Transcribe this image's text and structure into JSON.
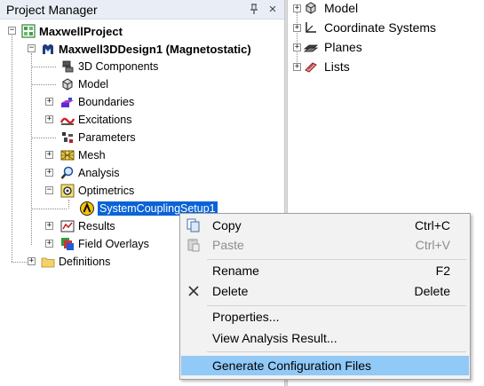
{
  "project_manager": {
    "title": "Project Manager",
    "pin_glyph": "×",
    "tree": {
      "project": "MaxwellProject",
      "design": "Maxwell3DDesign1 (Magnetostatic)",
      "nodes": {
        "components": "3D Components",
        "model": "Model",
        "boundaries": "Boundaries",
        "excitations": "Excitations",
        "parameters": "Parameters",
        "mesh": "Mesh",
        "analysis": "Analysis",
        "optimetrics": "Optimetrics",
        "setup": "SystemCouplingSetup1",
        "results": "Results",
        "field_overlays": "Field Overlays",
        "definitions": "Definitions"
      }
    }
  },
  "model_tree": {
    "items": [
      "Model",
      "Coordinate Systems",
      "Planes",
      "Lists"
    ]
  },
  "context_menu": {
    "copy": {
      "label": "Copy",
      "shortcut": "Ctrl+C"
    },
    "paste": {
      "label": "Paste",
      "shortcut": "Ctrl+V"
    },
    "rename": {
      "label": "Rename",
      "shortcut": "F2"
    },
    "delete": {
      "label": "Delete",
      "shortcut": "Delete"
    },
    "properties": {
      "label": "Properties..."
    },
    "view_result": {
      "label": "View Analysis Result..."
    },
    "generate": {
      "label": "Generate Configuration Files"
    }
  },
  "colors": {
    "selection": "#0a63d6",
    "menu_highlight": "#91c9f7",
    "header_bg": "#e9eef6"
  }
}
